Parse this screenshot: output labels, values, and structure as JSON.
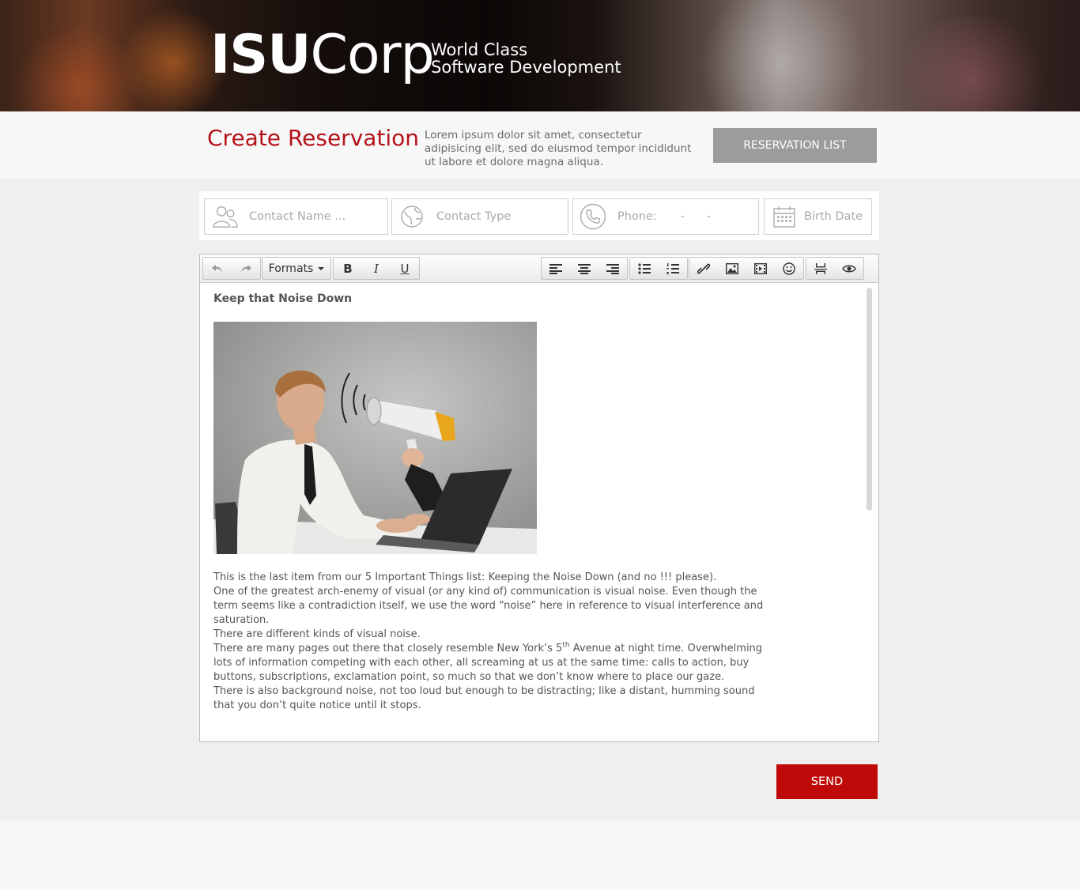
{
  "brand": {
    "logo_bold": "ISU",
    "logo_light": "Corp",
    "tagline_line1": "World Class",
    "tagline_line2": "Software Development"
  },
  "header": {
    "title": "Create Reservation",
    "description": "Lorem ipsum dolor sit amet, consectetur adipisicing elit, sed do eiusmod tempor incididunt ut labore et dolore magna aliqua.",
    "reservation_list_label": "RESERVATION LIST"
  },
  "form": {
    "contact_name_placeholder": "Contact Name ...",
    "contact_type_placeholder": "Contact Type",
    "phone_label": "Phone:",
    "phone_mask": "-      -",
    "birth_date_placeholder": "Birth Date"
  },
  "toolbar": {
    "formats_label": "Formats",
    "bold": "B",
    "italic": "I",
    "underline": "U"
  },
  "document": {
    "title": "Keep that Noise Down",
    "paragraphs": {
      "p1": "This is the last item from our 5 Important Things list: Keeping the Noise Down (and no !!! please).",
      "p2": "One of the greatest arch-enemy of visual (or any kind of) communication is visual noise. Even though the term seems like a contradiction itself, we use the word “noise” here in reference to visual interference and saturation.",
      "p3": "There are different kinds of visual noise.",
      "p4_a": "There are many pages out there that closely resemble New York’s 5",
      "p4_sup": "th",
      "p4_b": " Avenue at night time. Overwhelming lots of information competing with each other, all screaming at us at the same time: calls to action, buy buttons, subscriptions, exclamation point, so much so that we don’t know where to place our gaze.",
      "p5": "There is also background noise, not too loud but enough to be distracting; like a distant, humming sound that you don’t quite notice until it stops."
    }
  },
  "actions": {
    "send_label": "SEND"
  },
  "colors": {
    "accent": "#b5121b",
    "send": "#c00a0a",
    "secondary_button": "#9c9c9c"
  }
}
